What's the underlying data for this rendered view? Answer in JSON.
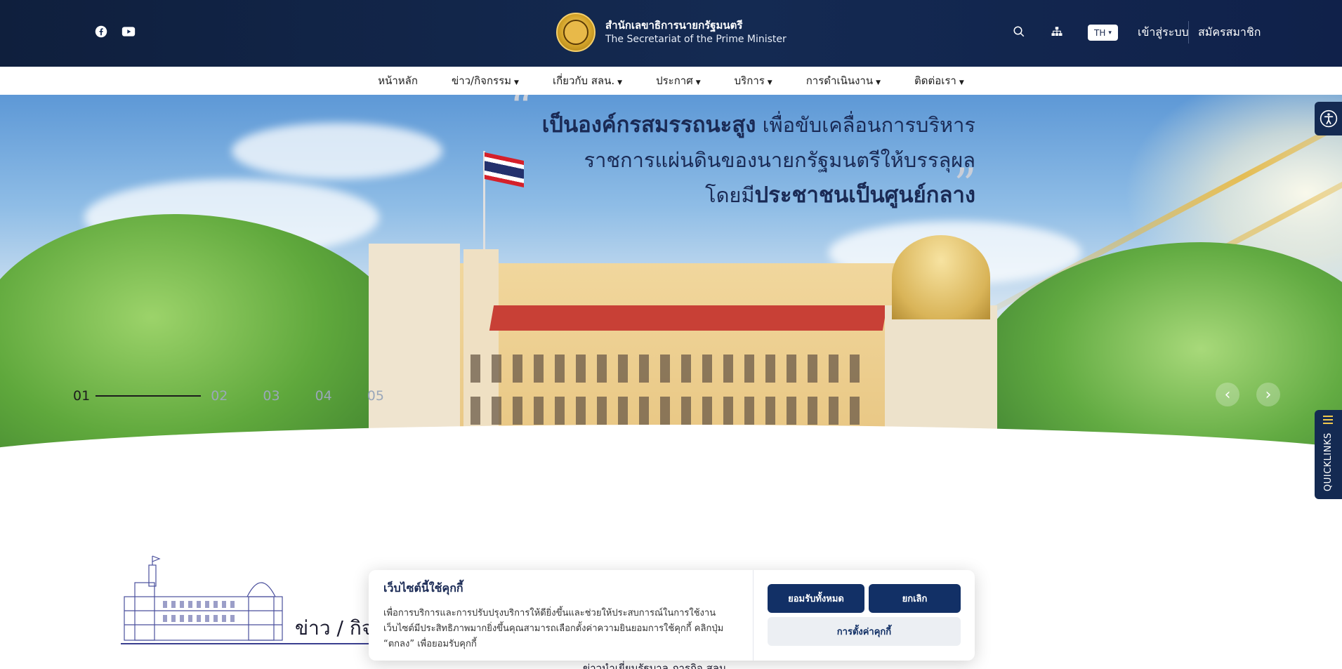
{
  "header": {
    "org_th": "สำนักเลขาธิการนายกรัฐมนตรี",
    "org_en": "The Secretariat of the Prime Minister",
    "language": "TH",
    "login_label": "เข้าสู่ระบบ",
    "register_label": "สมัครสมาชิก",
    "icons": [
      "facebook-icon",
      "youtube-icon",
      "search-icon",
      "sitemap-icon"
    ]
  },
  "nav": {
    "items": [
      {
        "label": "หน้าหลัก",
        "dropdown": false
      },
      {
        "label": "ข่าว/กิจกรรม",
        "dropdown": true
      },
      {
        "label": "เกี่ยวกับ สลน.",
        "dropdown": true
      },
      {
        "label": "ประกาศ",
        "dropdown": true
      },
      {
        "label": "บริการ",
        "dropdown": true
      },
      {
        "label": "การดำเนินงาน",
        "dropdown": true
      },
      {
        "label": "ติดต่อเรา",
        "dropdown": true
      }
    ]
  },
  "hero": {
    "line1_strong": "เป็นองค์กรสมรรถนะสูง",
    "line1_rest": "เพื่อขับเคลื่อนการบริหาร",
    "line2": "ราชการแผ่นดินของนายกรัฐมนตรีให้บรรลุผล",
    "line3_prefix": "โดยมี",
    "line3_strong": "ประชาชนเป็นศูนย์กลาง",
    "quote_open": "“",
    "quote_close": "”",
    "slides": [
      "01",
      "02",
      "03",
      "04",
      "05"
    ],
    "active_slide": "01"
  },
  "sidebar": {
    "quicklinks_label": "QUICKLINKS"
  },
  "news": {
    "title": "ข่าว / กิจ",
    "tabs_partial": "ข่าวนำเยี่ยมรัฐบาล    ภารกิจ สลน."
  },
  "cookie": {
    "title": "เว็บไซต์นี้ใช้คุกกี้",
    "body": "เพื่อการบริการและการปรับปรุงบริการให้ดียิ่งขึ้นและช่วยให้ประสบการณ์ในการใช้งานเว็บไซต์มีประสิทธิภาพมากยิ่งขึ้นคุณสามารถเลือกตั้งค่าความยินยอมการใช้คุกกี้ คลิกปุ่ม “ตกลง” เพื่อยอมรับคุกกี้",
    "accept_label": "ยอมรับทั้งหมด",
    "cancel_label": "ยกเลิก",
    "settings_label": "การตั้งค่าคุกกี้"
  },
  "colors": {
    "header_bg": "#142a52",
    "primary_button": "#123066",
    "secondary_button": "#eceff3"
  }
}
